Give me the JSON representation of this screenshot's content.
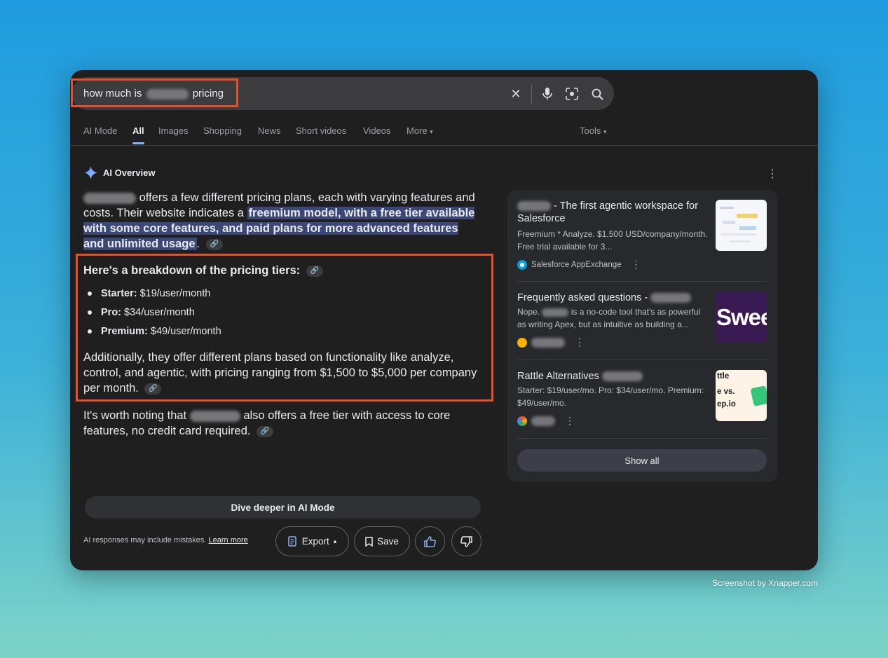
{
  "search": {
    "query_prefix": "how much is",
    "query_suffix": "pricing"
  },
  "tabs": [
    {
      "label": "AI Mode"
    },
    {
      "label": "All",
      "active": true
    },
    {
      "label": "Images"
    },
    {
      "label": "Shopping"
    },
    {
      "label": "News"
    },
    {
      "label": "Short videos"
    },
    {
      "label": "Videos"
    },
    {
      "label": "More"
    }
  ],
  "tools_label": "Tools",
  "overview": {
    "header": "AI Overview",
    "intro_1": "offers a few different pricing plans, each with varying features and costs. Their website indicates a ",
    "intro_highlight": "freemium model, with a free tier available with some core features, and paid plans for more advanced features and unlimited usage",
    "intro_end": ".",
    "breakdown_title": "Here's a breakdown of the pricing tiers:",
    "tiers": [
      {
        "name": "Starter:",
        "price": "$19/user/month"
      },
      {
        "name": "Pro:",
        "price": "$34/user/month"
      },
      {
        "name": "Premium:",
        "price": "$49/user/month"
      }
    ],
    "additional": "Additionally, they offer different plans based on functionality like analyze, control, and agentic, with pricing ranging from $1,500 to $5,000 per company per month.",
    "worth_1": "It's worth noting that",
    "worth_2": "also offers a free tier with access to core features, no credit card required.",
    "dive_deeper": "Dive deeper in AI Mode",
    "disclaimer": "AI responses may include mistakes.",
    "learn_more": "Learn more",
    "export": "Export",
    "save": "Save"
  },
  "sources": [
    {
      "title": "- The first agentic workspace for Salesforce",
      "snippet": "Freemium * Analyze. $1,500 USD/company/month. Free trial available for 3...",
      "source": "Salesforce AppExchange"
    },
    {
      "title": "Frequently asked questions -",
      "snippet_1": "Nope.",
      "snippet_2": "is a no-code tool that's as powerful as writing Apex, but as intuitive as building a...",
      "thumb_text": "Swee"
    },
    {
      "title": "Rattle Alternatives",
      "snippet": "Starter: $19/user/mo. Pro: $34/user/mo. Premium: $49/user/mo.",
      "thumb_text_1": "ttle",
      "thumb_text_2": "e vs.",
      "thumb_text_3": "ep.io"
    }
  ],
  "show_all": "Show all",
  "credit": "Screenshot by Xnapper.com",
  "colors": {
    "highlight": "#e5502a",
    "accent": "#8ab4f8",
    "mark_bg": "#3b4777"
  }
}
